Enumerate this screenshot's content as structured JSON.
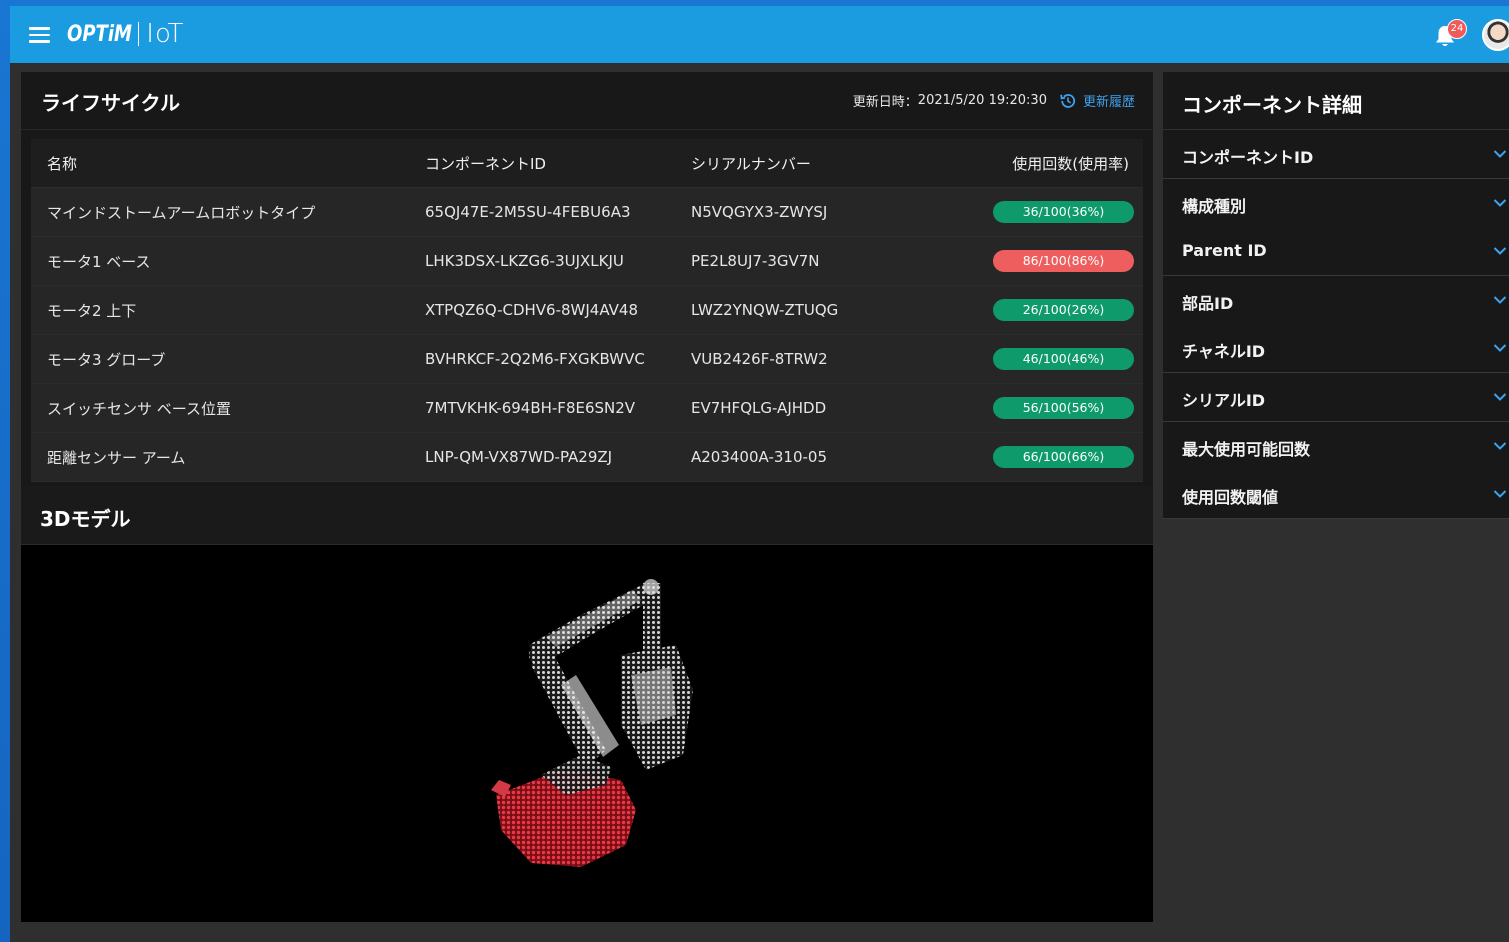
{
  "header": {
    "logo_optim": "OPTiM",
    "logo_iot": "IoT",
    "notification_count": "24"
  },
  "lifecycle": {
    "title": "ライフサイクル",
    "updated_label": "更新日時：",
    "updated_at": "2021/5/20 19:20:30",
    "history_link": "更新履歴",
    "columns": [
      "名称",
      "コンポーネントID",
      "シリアルナンバー",
      "使用回数(使用率)"
    ],
    "rows": [
      {
        "name": "マインドストームアームロボットタイプ",
        "component_id": "65QJ47E-2M5SU-4FEBU6A3",
        "serial": "N5VQGYX3-ZWYSJ",
        "usage": "36/100(36%)",
        "status": "ok"
      },
      {
        "name": "モータ1 ベース",
        "component_id": "LHK3DSX-LKZG6-3UJXLKJU",
        "serial": "PE2L8UJ7-3GV7N",
        "usage": "86/100(86%)",
        "status": "ng"
      },
      {
        "name": "モータ2 上下",
        "component_id": "XTPQZ6Q-CDHV6-8WJ4AV48",
        "serial": "LWZ2YNQW-ZTUQG",
        "usage": "26/100(26%)",
        "status": "ok"
      },
      {
        "name": "モータ3 グローブ",
        "component_id": "BVHRKCF-2Q2M6-FXGKBWVC",
        "serial": "VUB2426F-8TRW2",
        "usage": "46/100(46%)",
        "status": "ok"
      },
      {
        "name": "スイッチセンサ ベース位置",
        "component_id": "7MTVKHK-694BH-F8E6SN2V",
        "serial": "EV7HFQLG-AJHDD",
        "usage": "56/100(56%)",
        "status": "ok"
      },
      {
        "name": "距離センサー アーム",
        "component_id": "LNP-QM-VX87WD-PA29ZJ",
        "serial": "A203400A-310-05",
        "usage": "66/100(66%)",
        "status": "ok"
      }
    ]
  },
  "model": {
    "title": "3Dモデル"
  },
  "detail": {
    "title": "コンポーネント詳細",
    "items": [
      "コンポーネントID",
      "構成種別",
      "Parent ID",
      "部品ID",
      "チャネルID",
      "シリアルID",
      "最大使用可能回数",
      "使用回数閾値"
    ]
  },
  "colors": {
    "header": "#1b9be0",
    "ok": "#0f9a6c",
    "ng": "#ee5e5e",
    "link": "#3fa2ee"
  }
}
